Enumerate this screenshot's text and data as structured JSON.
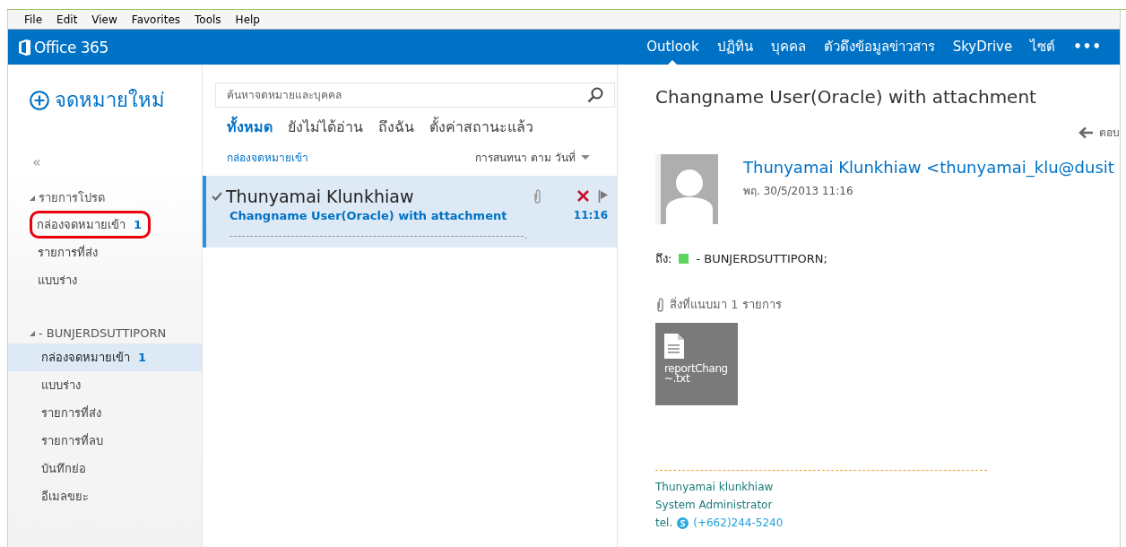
{
  "menu_bar": [
    "File",
    "Edit",
    "View",
    "Favorites",
    "Tools",
    "Help"
  ],
  "header": {
    "logo": "Office 365",
    "nav": [
      {
        "label": "Outlook",
        "selected": true
      },
      {
        "label": "ปฏิทิน",
        "selected": false
      },
      {
        "label": "บุคคล",
        "selected": false
      },
      {
        "label": "ตัวดึงข้อมูลข่าวสาร",
        "selected": false
      },
      {
        "label": "SkyDrive",
        "selected": false
      },
      {
        "label": "ไซต์",
        "selected": false
      },
      {
        "label": "•••",
        "selected": false
      }
    ]
  },
  "new_mail": "จดหมายใหม่",
  "collapse": "«",
  "folder_groups": [
    {
      "name": "รายการโปรด",
      "expanded": true,
      "folders": [
        {
          "name": "กล่องจดหมายเข้า",
          "count": "1",
          "selected": false,
          "highlighted": true
        },
        {
          "name": "รายการที่ส่ง",
          "selected": false,
          "highlighted": false
        },
        {
          "name": "แบบร่าง",
          "selected": false,
          "highlighted": false
        }
      ]
    },
    {
      "name": "- BUNJERDSUTTIPORN",
      "expanded": true,
      "folders": [
        {
          "name": "กล่องจดหมายเข้า",
          "count": "1",
          "selected": true,
          "highlighted": false
        },
        {
          "name": "แบบร่าง",
          "selected": false,
          "highlighted": false
        },
        {
          "name": "รายการที่ส่ง",
          "selected": false,
          "highlighted": false
        },
        {
          "name": "รายการที่ลบ",
          "selected": false,
          "highlighted": false
        },
        {
          "name": "บันทึกย่อ",
          "selected": false,
          "highlighted": false
        },
        {
          "name": "อีเมลขยะ",
          "selected": false,
          "highlighted": false
        }
      ]
    }
  ],
  "search": {
    "placeholder": "ค้นหาจดหมายและบุคคล"
  },
  "filters": [
    {
      "label": "ทั้งหมด",
      "selected": true
    },
    {
      "label": "ยังไม่ได้อ่าน",
      "selected": false
    },
    {
      "label": "ถึงฉัน",
      "selected": false
    },
    {
      "label": "ตั้งค่าสถานะแล้ว",
      "selected": false
    }
  ],
  "folder_title": "กล่องจดหมายเข้า",
  "sort": "การสนทนา ตาม วันที่",
  "messages": [
    {
      "sender": "Thunyamai Klunkhiaw",
      "subject": "Changname User(Oracle) with attachment",
      "preview": "------------------------------------------------------------------------.",
      "time": "11:16",
      "selected": true,
      "has_attachment": true
    }
  ],
  "reading": {
    "subject": "Changname User(Oracle) with attachment",
    "reply": "ตอบ",
    "from": "Thunyamai Klunkhiaw <thunyamai_klu@dusit",
    "date": "พฤ. 30/5/2013 11:16",
    "to_label": "ถึง:",
    "recipients": [
      {
        "name": "- BUNJERDSUTTIPORN;",
        "color": "#5cd65c"
      }
    ],
    "attachments_label": "สิ่งที่แนบมา 1 รายการ",
    "attachments": [
      {
        "lines": [
          "reportChang",
          "~.txt"
        ]
      }
    ],
    "signature": {
      "lines": [
        "Thunyamai klunkhiaw",
        "System Administrator"
      ],
      "tel_label": "tel.",
      "phone": "(+662)244-5240"
    }
  }
}
